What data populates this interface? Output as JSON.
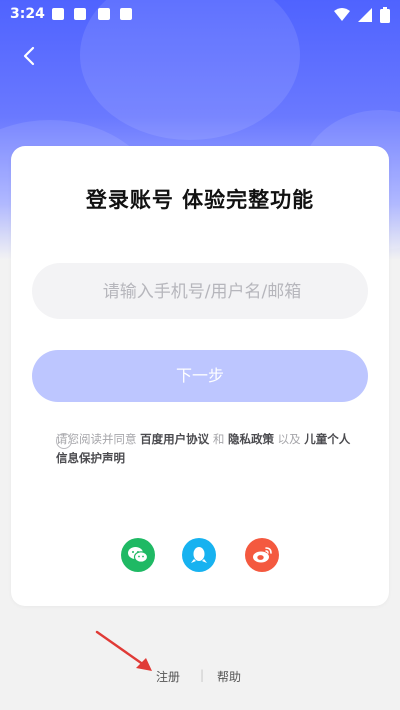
{
  "status_bar": {
    "time": "3:24"
  },
  "header": {
    "back_label": "返回"
  },
  "login": {
    "title": "登录账号 体验完整功能",
    "input_placeholder": "请输入手机号/用户名/邮箱",
    "next_label": "下一步",
    "agreement": {
      "prefix": "请您阅读并同意",
      "link1": "百度用户协议",
      "and": "和",
      "link2": "隐私政策",
      "suffix": "以及",
      "link3": "儿童个人信息保护声明"
    }
  },
  "footer": {
    "register": "注册",
    "separator": "|",
    "help": "帮助"
  },
  "colors": {
    "brand_blue": "#4f63ff",
    "button_disabled": "#bdc6ff",
    "wechat": "#1fb964",
    "qq": "#17b2f0",
    "weibo": "#f4593f",
    "arrow_red": "#e03a36"
  }
}
